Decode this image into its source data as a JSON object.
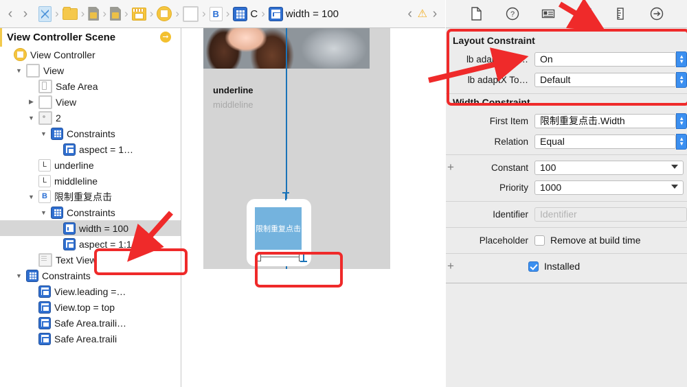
{
  "jumpbar": {
    "back_label": "‹",
    "forward_label": "›",
    "separator": "›",
    "crumbs": [
      {
        "icon": "xcodeproj-icon",
        "label": ""
      },
      {
        "icon": "folder-icon",
        "label": ""
      },
      {
        "icon": "source-file-icon",
        "label": ""
      },
      {
        "icon": "source-file-icon",
        "label": ""
      },
      {
        "icon": "storyboard-icon",
        "label": ""
      },
      {
        "icon": "scene-icon",
        "label": ""
      },
      {
        "icon": "view-icon",
        "label": ""
      },
      {
        "icon": "button-icon",
        "label": ""
      },
      {
        "icon": "constraints-icon",
        "label": "C"
      },
      {
        "icon": "width-constraint-icon",
        "label": "width = 100"
      }
    ],
    "issue_prev": "‹",
    "issue_icon": "warning-triangle-icon",
    "issue_next": "›"
  },
  "inspector_tabs": [
    {
      "name": "file-inspector-tab",
      "icon": "document-icon",
      "selected": false
    },
    {
      "name": "quick-help-inspector-tab",
      "icon": "question-circle-icon",
      "selected": false
    },
    {
      "name": "identity-inspector-tab",
      "icon": "id-card-icon",
      "selected": false
    },
    {
      "name": "attributes-inspector-tab",
      "icon": "down-arrow-shield-icon",
      "selected": true
    },
    {
      "name": "size-inspector-tab",
      "icon": "ruler-icon",
      "selected": false
    },
    {
      "name": "connections-inspector-tab",
      "icon": "right-arrow-circle-icon",
      "selected": false
    }
  ],
  "sidebar": {
    "header": "View Controller Scene",
    "header_arrow_icon": "right-arrow-circle-icon",
    "rows": [
      {
        "label": "View Controller",
        "indent": 0,
        "disclosure": "none",
        "icon": "view-controller-icon",
        "selected": false
      },
      {
        "label": "View",
        "indent": 1,
        "disclosure": "open",
        "icon": "view-icon",
        "selected": false
      },
      {
        "label": "Safe Area",
        "indent": 2,
        "disclosure": "none",
        "icon": "safe-area-icon",
        "selected": false
      },
      {
        "label": "View",
        "indent": 2,
        "disclosure": "closed",
        "icon": "view-icon",
        "selected": false
      },
      {
        "label": "2",
        "indent": 2,
        "disclosure": "open",
        "icon": "image-view-icon",
        "selected": false
      },
      {
        "label": "Constraints",
        "indent": 3,
        "disclosure": "open",
        "icon": "constraints-icon",
        "selected": false
      },
      {
        "label": "aspect = 1…",
        "indent": 4,
        "disclosure": "none",
        "icon": "aspect-constraint-icon",
        "selected": false
      },
      {
        "label": "underline",
        "indent": 2,
        "disclosure": "none",
        "icon": "label-icon",
        "selected": false
      },
      {
        "label": "middleline",
        "indent": 2,
        "disclosure": "none",
        "icon": "label-icon",
        "selected": false
      },
      {
        "label": "限制重复点击",
        "indent": 2,
        "disclosure": "open",
        "icon": "button-icon",
        "selected": false
      },
      {
        "label": "Constraints",
        "indent": 3,
        "disclosure": "open",
        "icon": "constraints-icon",
        "selected": false
      },
      {
        "label": "width = 100",
        "indent": 4,
        "disclosure": "none",
        "icon": "width-constraint-icon",
        "selected": true
      },
      {
        "label": "aspect = 1:1",
        "indent": 4,
        "disclosure": "none",
        "icon": "aspect-constraint-icon",
        "selected": false
      },
      {
        "label": "Text View",
        "indent": 2,
        "disclosure": "none",
        "icon": "text-view-icon",
        "selected": false
      },
      {
        "label": "Constraints",
        "indent": 1,
        "disclosure": "open",
        "icon": "constraints-icon",
        "selected": false
      },
      {
        "label": "View.leading =…",
        "indent": 2,
        "disclosure": "none",
        "icon": "leading-constraint-icon",
        "selected": false
      },
      {
        "label": "View.top = top",
        "indent": 2,
        "disclosure": "none",
        "icon": "leading-constraint-icon",
        "selected": false
      },
      {
        "label": "Safe Area.traili…",
        "indent": 2,
        "disclosure": "none",
        "icon": "leading-constraint-icon",
        "selected": false
      },
      {
        "label": "Safe Area.traili",
        "indent": 2,
        "disclosure": "none",
        "icon": "leading-constraint-icon",
        "selected": false
      }
    ]
  },
  "canvas": {
    "underline_label": "underline",
    "middleline_label": "middleline",
    "button_label": "限制重复点击"
  },
  "inspector": {
    "layout_constraint": {
      "title": "Layout Constraint",
      "fields": [
        {
          "label": "lb adapt Con…",
          "value": "On",
          "name": "lb-adapt-con-field"
        },
        {
          "label": "lb adaptX To…",
          "value": "Default",
          "name": "lb-adaptx-to-field"
        }
      ]
    },
    "width_constraint": {
      "title": "Width Constraint",
      "first_item_label": "First Item",
      "first_item_value": "限制重复点击.Width",
      "relation_label": "Relation",
      "relation_value": "Equal",
      "constant_label": "Constant",
      "constant_value": "100",
      "priority_label": "Priority",
      "priority_value": "1000",
      "identifier_label": "Identifier",
      "identifier_placeholder": "Identifier",
      "identifier_value": "",
      "placeholder_label": "Placeholder",
      "placeholder_checkbox_label": "Remove at build time",
      "placeholder_checked": false,
      "installed_label": "Installed",
      "installed_checked": true,
      "add_symbol": "+"
    }
  },
  "colors": {
    "accent_blue": "#3b8ff0",
    "annotation_red": "#ef2a2a",
    "selection_grey": "#d6d6d6",
    "constraint_blue": "#2f6fd0",
    "yellow": "#f3c02f"
  }
}
